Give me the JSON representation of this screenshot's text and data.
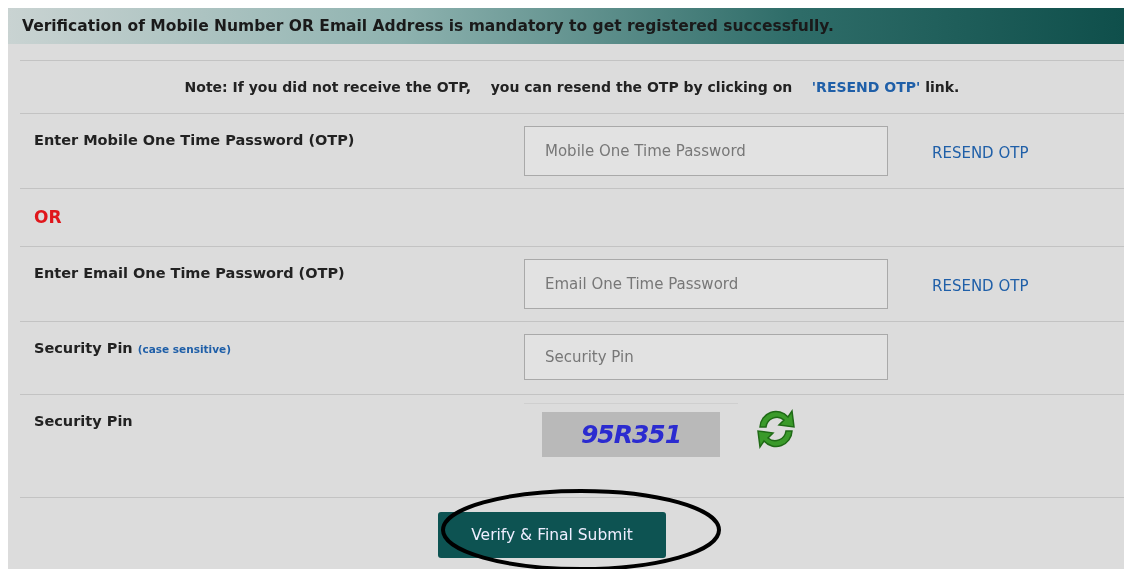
{
  "header": {
    "title": "Verification of Mobile Number OR Email Address is mandatory to get registered successfully."
  },
  "note": {
    "text": "Note: If you did not receive the OTP,    you can resend the OTP by clicking on",
    "link": "'RESEND OTP'",
    "suffix": "link."
  },
  "rows": [
    {
      "kind": "otp",
      "label": "Enter Mobile One Time Password (OTP)",
      "placeholder": "Mobile One Time Password",
      "link": "RESEND OTP"
    },
    {
      "kind": "or",
      "label": "OR"
    },
    {
      "kind": "otp",
      "label": "Enter Email One Time Password (OTP)",
      "placeholder": "Email One Time Password",
      "link": "RESEND OTP"
    },
    {
      "kind": "pin",
      "label": "Security Pin",
      "hint": "(case sensitive)",
      "placeholder": "Security Pin"
    },
    {
      "kind": "captcha",
      "label": "Security Pin",
      "captcha": "95R351"
    }
  ],
  "submit": {
    "label": "Verify & Final Submit",
    "highlighted": true
  }
}
